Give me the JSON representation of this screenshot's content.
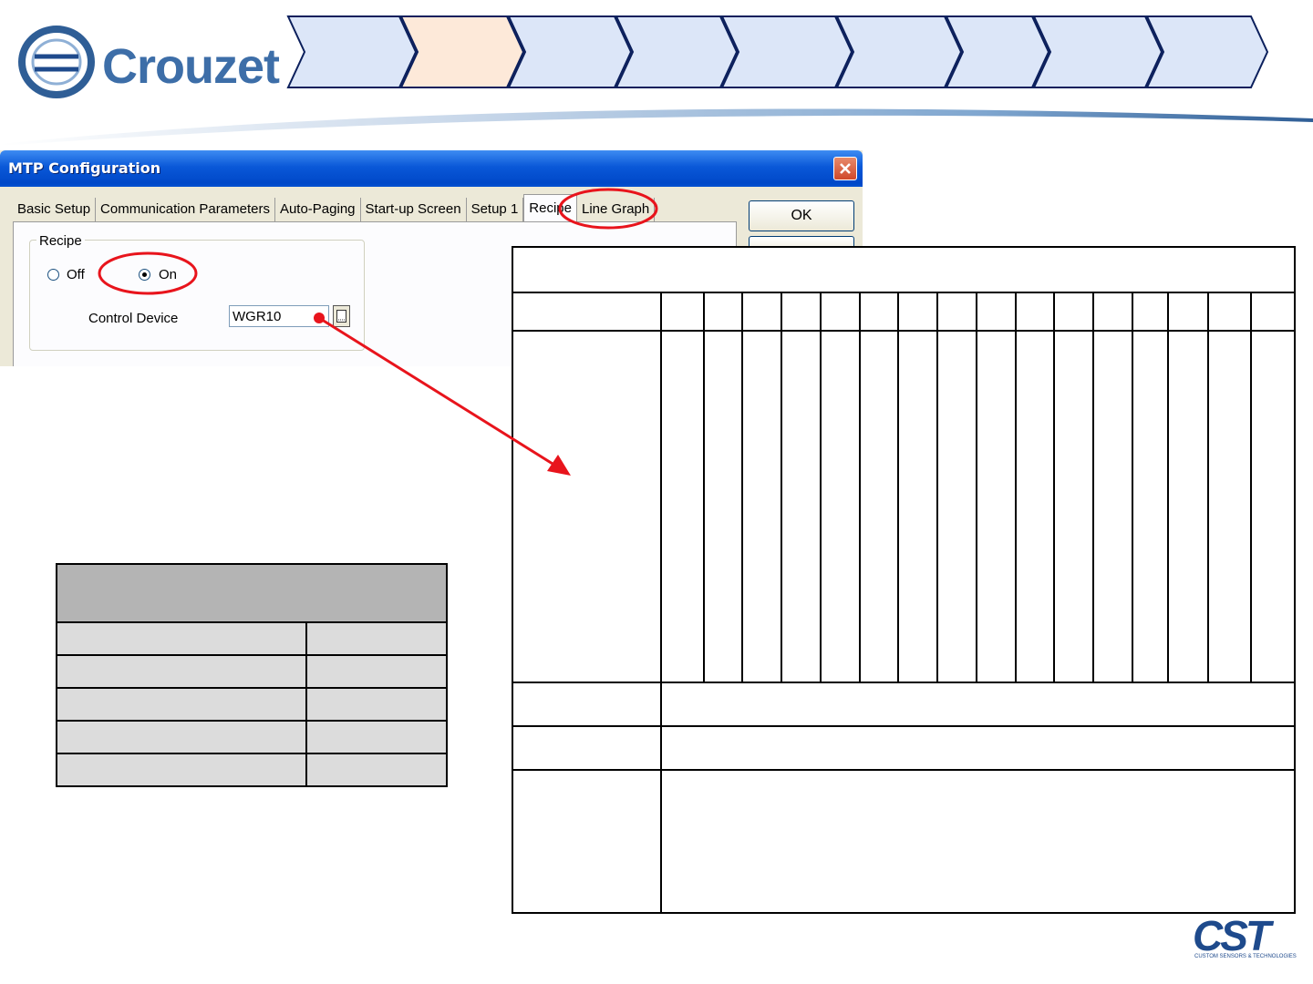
{
  "brand": {
    "logo_text": "Crouzet",
    "footer_logo_text": "CST",
    "footer_logo_subtitle": "CUSTOM SENSORS & TECHNOLOGIES"
  },
  "process_steps": {
    "count": 9,
    "active_index": 1,
    "active_color": "#fde9d9",
    "inactive_color": "#dce6f8"
  },
  "dialog": {
    "title": "MTP Configuration",
    "tabs": [
      "Basic Setup",
      "Communication Parameters",
      "Auto-Paging",
      "Start-up Screen",
      "Setup 1",
      "Recipe",
      "Line Graph"
    ],
    "active_tab": "Recipe",
    "ok_label": "OK",
    "recipe_group_label": "Recipe",
    "radio_off_label": "Off",
    "radio_on_label": "On",
    "selected_option": "On",
    "control_device_label": "Control Device",
    "control_device_value": "WGR10"
  },
  "colors": {
    "highlight": "#e8141c",
    "arrow": "#e8141c"
  },
  "small_table": {
    "header_rows": 1,
    "body_rows": 5,
    "columns": 2
  },
  "big_table": {
    "value_columns": 16
  }
}
